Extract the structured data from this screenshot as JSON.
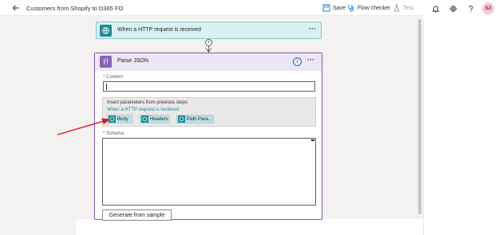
{
  "header": {
    "title": "Customers from Shopify to D365 FO",
    "save_label": "Save",
    "flow_checker_label": "Flow checker",
    "test_label": "Test"
  },
  "user": {
    "initials": "SJ"
  },
  "icons": {
    "back": "arrow-left-icon",
    "save": "save-icon",
    "flow_checker": "stethoscope-icon",
    "test": "flask-icon",
    "notifications": "bell-icon",
    "settings": "gear-icon",
    "help": "question-icon"
  },
  "trigger": {
    "label": "When a HTTP request is received",
    "more": "···"
  },
  "parse_json": {
    "title": "Parse JSON",
    "icon_glyph": "{⁄}",
    "more": "···",
    "content_label": "* Content",
    "params_title": "Insert parameters from previous steps",
    "params_source": "When a HTTP request is received",
    "chips": [
      "Body",
      "Headers",
      "Path Para..."
    ],
    "schema_label": "* Schema",
    "generate_label": "Generate from sample"
  },
  "colors": {
    "accent_purple": "#8764b8",
    "accent_teal": "#1e8a91",
    "annotation_red": "#e81123"
  }
}
